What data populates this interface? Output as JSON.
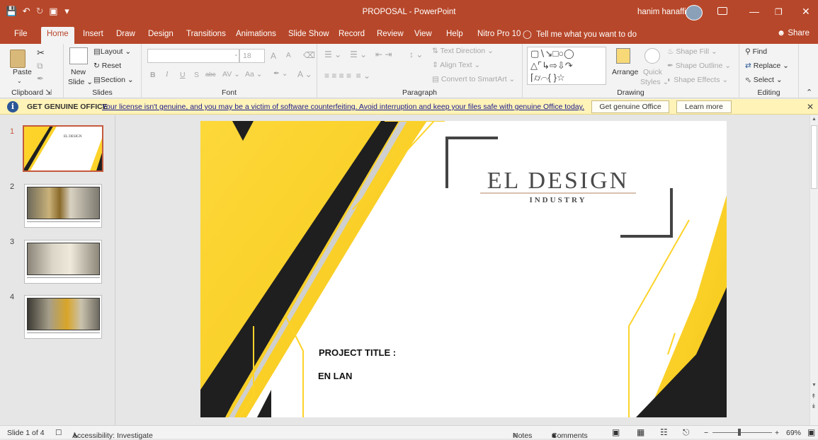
{
  "titlebar": {
    "title": "PROPOSAL  -  PowerPoint",
    "user": "hanim hanaffi"
  },
  "tabs": [
    "File",
    "Home",
    "Insert",
    "Draw",
    "Design",
    "Transitions",
    "Animations",
    "Slide Show",
    "Record",
    "Review",
    "View",
    "Help",
    "Nitro Pro 10"
  ],
  "tell_me": "Tell me what you want to do",
  "share": "Share",
  "ribbon": {
    "clipboard": {
      "label": "Clipboard",
      "paste": "Paste"
    },
    "slides": {
      "label": "Slides",
      "new_slide_1": "New",
      "new_slide_2": "Slide",
      "layout": "Layout",
      "reset": "Reset",
      "section": "Section"
    },
    "font": {
      "label": "Font",
      "size": "18",
      "bold": "B",
      "italic": "I",
      "underline": "U",
      "strike": "S",
      "abc": "abc",
      "spacing": "AV",
      "case": "Aa",
      "grow": "A",
      "shrink": "A",
      "color": "A"
    },
    "paragraph": {
      "label": "Paragraph",
      "text_direction": "Text Direction",
      "align_text": "Align Text",
      "convert": "Convert to SmartArt"
    },
    "drawing": {
      "label": "Drawing",
      "arrange": "Arrange",
      "quick_1": "Quick",
      "quick_2": "Styles",
      "shape_fill": "Shape Fill",
      "shape_outline": "Shape Outline",
      "shape_effects": "Shape Effects"
    },
    "editing": {
      "label": "Editing",
      "find": "Find",
      "replace": "Replace",
      "select": "Select"
    }
  },
  "message_bar": {
    "heading": "GET GENUINE OFFICE",
    "text": "Your license isn't genuine, and you may be a victim of software counterfeiting. Avoid interruption and keep your files safe with genuine Office today.",
    "button1": "Get genuine Office",
    "button2": "Learn more"
  },
  "thumbnails": [
    "1",
    "2",
    "3",
    "4"
  ],
  "thumb1": {
    "title": "EL DESIGN",
    "sub": "INDUSTRY"
  },
  "slide": {
    "brand": "EL DESIGN",
    "brand_sub": "INDUSTRY",
    "project_title": "PROJECT TITLE :",
    "subtitle": "EN LAN"
  },
  "status": {
    "slide": "Slide 1 of 4",
    "accessibility": "Accessibility: Investigate",
    "notes": "Notes",
    "comments": "Comments",
    "zoom": "69%"
  },
  "colors": {
    "accent": "#b7472a",
    "yellow": "#fdd32a",
    "dark": "#1f1f1f"
  }
}
